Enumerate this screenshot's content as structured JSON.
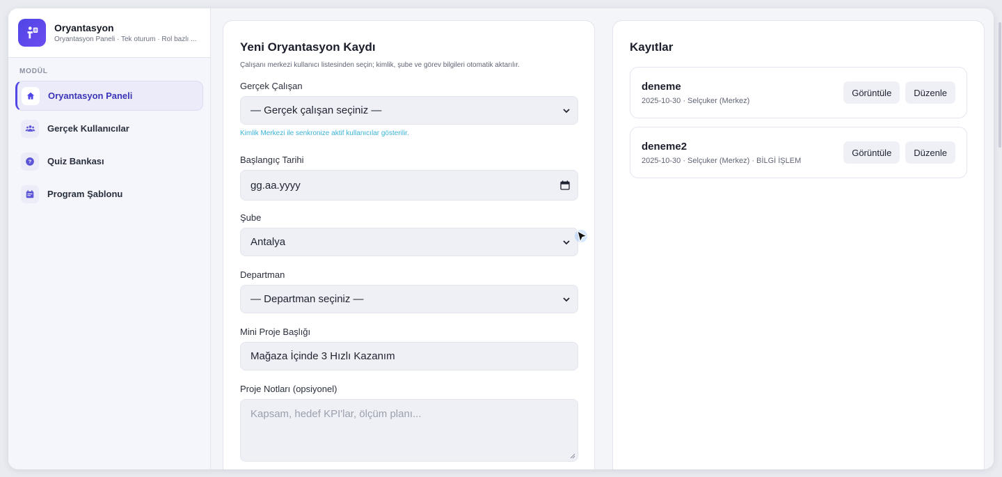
{
  "brand": {
    "title": "Oryantasyon",
    "subtitle": "Oryantasyon Paneli · Tek oturum · Rol bazlı ..."
  },
  "sidebar": {
    "section_label": "MODÜL",
    "items": [
      {
        "label": "Oryantasyon Paneli",
        "icon": "home-icon",
        "active": true
      },
      {
        "label": "Gerçek Kullanıcılar",
        "icon": "users-icon",
        "active": false
      },
      {
        "label": "Quiz Bankası",
        "icon": "question-icon",
        "active": false
      },
      {
        "label": "Program Şablonu",
        "icon": "calendar-icon",
        "active": false
      }
    ]
  },
  "form": {
    "title": "Yeni Oryantasyon Kaydı",
    "description": "Çalışanı merkezi kullanıcı listesinden seçin; kimlik, şube ve görev bilgileri otomatik aktarılır.",
    "employee": {
      "label": "Gerçek Çalışan",
      "value": "— Gerçek çalışan seçiniz —",
      "hint": "Kimlik Merkezi ile senkronize aktif kullanıcılar gösterilir."
    },
    "start_date": {
      "label": "Başlangıç Tarihi",
      "value": "gg.aa.yyyy"
    },
    "branch": {
      "label": "Şube",
      "value": "Antalya"
    },
    "department": {
      "label": "Departman",
      "value": "— Departman seçiniz —"
    },
    "project_title": {
      "label": "Mini Proje Başlığı",
      "value": "Mağaza İçinde 3 Hızlı Kazanım"
    },
    "project_notes": {
      "label": "Proje Notları (opsiyonel)",
      "placeholder": "Kapsam, hedef KPI'lar, ölçüm planı..."
    }
  },
  "records": {
    "title": "Kayıtlar",
    "view_label": "Görüntüle",
    "edit_label": "Düzenle",
    "items": [
      {
        "name": "deneme",
        "meta": "2025-10-30 · Selçuker (Merkez)"
      },
      {
        "name": "deneme2",
        "meta": "2025-10-30 · Selçuker (Merkez) · BİLGİ İŞLEM"
      }
    ]
  },
  "colors": {
    "accent": "#4f46e5",
    "hint": "#3ab3d6",
    "background": "#f4f5f9"
  }
}
